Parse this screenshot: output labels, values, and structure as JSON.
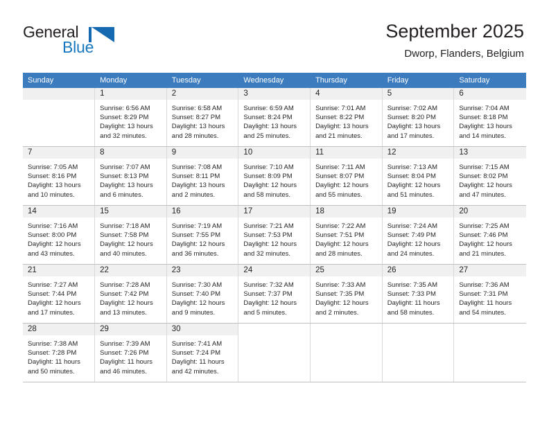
{
  "brand": {
    "word_one": "General",
    "word_two": "Blue",
    "logo_icon": "blue-triangle-flag-icon",
    "accent_color": "#1569b0"
  },
  "header": {
    "title": "September 2025",
    "subtitle": "Dworp, Flanders, Belgium"
  },
  "calendar": {
    "header_color": "#3c7cbe",
    "day_names": [
      "Sunday",
      "Monday",
      "Tuesday",
      "Wednesday",
      "Thursday",
      "Friday",
      "Saturday"
    ],
    "labels": {
      "sunrise": "Sunrise:",
      "sunset": "Sunset:",
      "daylight": "Daylight:"
    },
    "weeks": [
      [
        {
          "day": "",
          "empty": true
        },
        {
          "day": "1",
          "sunrise": "Sunrise: 6:56 AM",
          "sunset": "Sunset: 8:29 PM",
          "daylight_1": "Daylight: 13 hours",
          "daylight_2": "and 32 minutes."
        },
        {
          "day": "2",
          "sunrise": "Sunrise: 6:58 AM",
          "sunset": "Sunset: 8:27 PM",
          "daylight_1": "Daylight: 13 hours",
          "daylight_2": "and 28 minutes."
        },
        {
          "day": "3",
          "sunrise": "Sunrise: 6:59 AM",
          "sunset": "Sunset: 8:24 PM",
          "daylight_1": "Daylight: 13 hours",
          "daylight_2": "and 25 minutes."
        },
        {
          "day": "4",
          "sunrise": "Sunrise: 7:01 AM",
          "sunset": "Sunset: 8:22 PM",
          "daylight_1": "Daylight: 13 hours",
          "daylight_2": "and 21 minutes."
        },
        {
          "day": "5",
          "sunrise": "Sunrise: 7:02 AM",
          "sunset": "Sunset: 8:20 PM",
          "daylight_1": "Daylight: 13 hours",
          "daylight_2": "and 17 minutes."
        },
        {
          "day": "6",
          "sunrise": "Sunrise: 7:04 AM",
          "sunset": "Sunset: 8:18 PM",
          "daylight_1": "Daylight: 13 hours",
          "daylight_2": "and 14 minutes."
        }
      ],
      [
        {
          "day": "7",
          "sunrise": "Sunrise: 7:05 AM",
          "sunset": "Sunset: 8:16 PM",
          "daylight_1": "Daylight: 13 hours",
          "daylight_2": "and 10 minutes."
        },
        {
          "day": "8",
          "sunrise": "Sunrise: 7:07 AM",
          "sunset": "Sunset: 8:13 PM",
          "daylight_1": "Daylight: 13 hours",
          "daylight_2": "and 6 minutes."
        },
        {
          "day": "9",
          "sunrise": "Sunrise: 7:08 AM",
          "sunset": "Sunset: 8:11 PM",
          "daylight_1": "Daylight: 13 hours",
          "daylight_2": "and 2 minutes."
        },
        {
          "day": "10",
          "sunrise": "Sunrise: 7:10 AM",
          "sunset": "Sunset: 8:09 PM",
          "daylight_1": "Daylight: 12 hours",
          "daylight_2": "and 58 minutes."
        },
        {
          "day": "11",
          "sunrise": "Sunrise: 7:11 AM",
          "sunset": "Sunset: 8:07 PM",
          "daylight_1": "Daylight: 12 hours",
          "daylight_2": "and 55 minutes."
        },
        {
          "day": "12",
          "sunrise": "Sunrise: 7:13 AM",
          "sunset": "Sunset: 8:04 PM",
          "daylight_1": "Daylight: 12 hours",
          "daylight_2": "and 51 minutes."
        },
        {
          "day": "13",
          "sunrise": "Sunrise: 7:15 AM",
          "sunset": "Sunset: 8:02 PM",
          "daylight_1": "Daylight: 12 hours",
          "daylight_2": "and 47 minutes."
        }
      ],
      [
        {
          "day": "14",
          "sunrise": "Sunrise: 7:16 AM",
          "sunset": "Sunset: 8:00 PM",
          "daylight_1": "Daylight: 12 hours",
          "daylight_2": "and 43 minutes."
        },
        {
          "day": "15",
          "sunrise": "Sunrise: 7:18 AM",
          "sunset": "Sunset: 7:58 PM",
          "daylight_1": "Daylight: 12 hours",
          "daylight_2": "and 40 minutes."
        },
        {
          "day": "16",
          "sunrise": "Sunrise: 7:19 AM",
          "sunset": "Sunset: 7:55 PM",
          "daylight_1": "Daylight: 12 hours",
          "daylight_2": "and 36 minutes."
        },
        {
          "day": "17",
          "sunrise": "Sunrise: 7:21 AM",
          "sunset": "Sunset: 7:53 PM",
          "daylight_1": "Daylight: 12 hours",
          "daylight_2": "and 32 minutes."
        },
        {
          "day": "18",
          "sunrise": "Sunrise: 7:22 AM",
          "sunset": "Sunset: 7:51 PM",
          "daylight_1": "Daylight: 12 hours",
          "daylight_2": "and 28 minutes."
        },
        {
          "day": "19",
          "sunrise": "Sunrise: 7:24 AM",
          "sunset": "Sunset: 7:49 PM",
          "daylight_1": "Daylight: 12 hours",
          "daylight_2": "and 24 minutes."
        },
        {
          "day": "20",
          "sunrise": "Sunrise: 7:25 AM",
          "sunset": "Sunset: 7:46 PM",
          "daylight_1": "Daylight: 12 hours",
          "daylight_2": "and 21 minutes."
        }
      ],
      [
        {
          "day": "21",
          "sunrise": "Sunrise: 7:27 AM",
          "sunset": "Sunset: 7:44 PM",
          "daylight_1": "Daylight: 12 hours",
          "daylight_2": "and 17 minutes."
        },
        {
          "day": "22",
          "sunrise": "Sunrise: 7:28 AM",
          "sunset": "Sunset: 7:42 PM",
          "daylight_1": "Daylight: 12 hours",
          "daylight_2": "and 13 minutes."
        },
        {
          "day": "23",
          "sunrise": "Sunrise: 7:30 AM",
          "sunset": "Sunset: 7:40 PM",
          "daylight_1": "Daylight: 12 hours",
          "daylight_2": "and 9 minutes."
        },
        {
          "day": "24",
          "sunrise": "Sunrise: 7:32 AM",
          "sunset": "Sunset: 7:37 PM",
          "daylight_1": "Daylight: 12 hours",
          "daylight_2": "and 5 minutes."
        },
        {
          "day": "25",
          "sunrise": "Sunrise: 7:33 AM",
          "sunset": "Sunset: 7:35 PM",
          "daylight_1": "Daylight: 12 hours",
          "daylight_2": "and 2 minutes."
        },
        {
          "day": "26",
          "sunrise": "Sunrise: 7:35 AM",
          "sunset": "Sunset: 7:33 PM",
          "daylight_1": "Daylight: 11 hours",
          "daylight_2": "and 58 minutes."
        },
        {
          "day": "27",
          "sunrise": "Sunrise: 7:36 AM",
          "sunset": "Sunset: 7:31 PM",
          "daylight_1": "Daylight: 11 hours",
          "daylight_2": "and 54 minutes."
        }
      ],
      [
        {
          "day": "28",
          "sunrise": "Sunrise: 7:38 AM",
          "sunset": "Sunset: 7:28 PM",
          "daylight_1": "Daylight: 11 hours",
          "daylight_2": "and 50 minutes."
        },
        {
          "day": "29",
          "sunrise": "Sunrise: 7:39 AM",
          "sunset": "Sunset: 7:26 PM",
          "daylight_1": "Daylight: 11 hours",
          "daylight_2": "and 46 minutes."
        },
        {
          "day": "30",
          "sunrise": "Sunrise: 7:41 AM",
          "sunset": "Sunset: 7:24 PM",
          "daylight_1": "Daylight: 11 hours",
          "daylight_2": "and 42 minutes."
        },
        {
          "day": "",
          "empty": true,
          "blank_band": true
        },
        {
          "day": "",
          "empty": true,
          "blank_band": true
        },
        {
          "day": "",
          "empty": true,
          "blank_band": true
        },
        {
          "day": "",
          "empty": true,
          "blank_band": true
        }
      ]
    ]
  }
}
